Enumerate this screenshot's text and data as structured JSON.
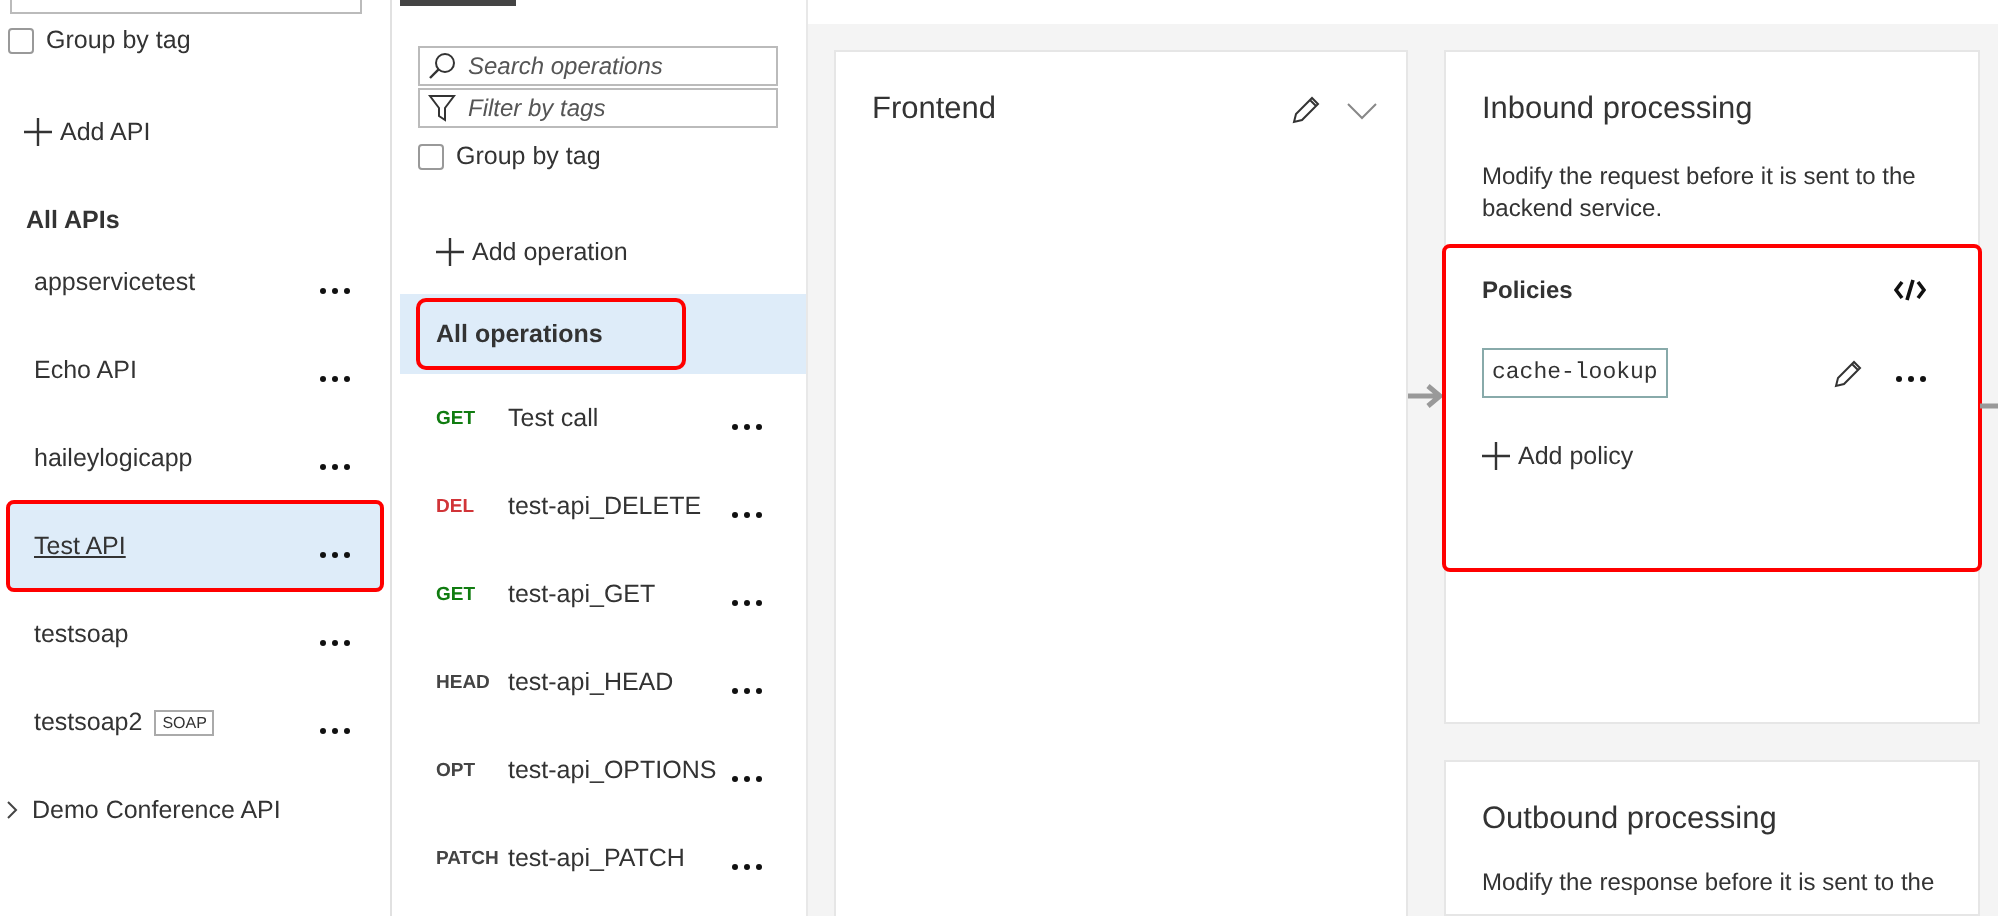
{
  "api_panel": {
    "group_by_tag": {
      "label": "Group by tag",
      "checked": false
    },
    "add_button": "Add API",
    "heading": "All APIs",
    "apis": [
      {
        "name": "appservicetest",
        "selected": false,
        "highlighted": false
      },
      {
        "name": "Echo API",
        "selected": false,
        "highlighted": false
      },
      {
        "name": "haileylogicapp",
        "selected": false,
        "highlighted": false
      },
      {
        "name": "Test API",
        "selected": true,
        "highlighted": true
      },
      {
        "name": "testsoap",
        "selected": false,
        "highlighted": false
      },
      {
        "name": "testsoap2",
        "badge": "SOAP",
        "selected": false,
        "highlighted": false
      }
    ],
    "groups": [
      {
        "name": "Demo Conference API",
        "expanded": false
      }
    ]
  },
  "operations_panel": {
    "search": {
      "placeholder": "Search operations"
    },
    "filter": {
      "placeholder": "Filter by tags"
    },
    "group_by_tag": {
      "label": "Group by tag",
      "checked": false
    },
    "add_button": "Add operation",
    "all_operations": {
      "label": "All operations",
      "selected": true,
      "highlighted": true
    },
    "operations": [
      {
        "method": "GET",
        "kind": "get",
        "name": "Test call",
        "selected": false
      },
      {
        "method": "DEL",
        "kind": "delete",
        "name": "test-api_DELETE",
        "selected": false
      },
      {
        "method": "GET",
        "kind": "get",
        "name": "test-api_GET",
        "selected": false
      },
      {
        "method": "HEAD",
        "kind": "other",
        "name": "test-api_HEAD",
        "selected": false
      },
      {
        "method": "OPT",
        "kind": "other",
        "name": "test-api_OPTIONS",
        "selected": false
      },
      {
        "method": "PATCH",
        "kind": "other",
        "name": "test-api_PATCH",
        "selected": false
      }
    ]
  },
  "frontend": {
    "title": "Frontend"
  },
  "inbound": {
    "title": "Inbound processing",
    "description": "Modify the request before it is sent to the backend service.",
    "policies": {
      "title": "Policies",
      "highlighted": true,
      "items": [
        "cache-lookup"
      ],
      "add_button": "Add policy"
    }
  },
  "outbound": {
    "title": "Outbound processing",
    "description": "Modify the response before it is sent to the"
  }
}
